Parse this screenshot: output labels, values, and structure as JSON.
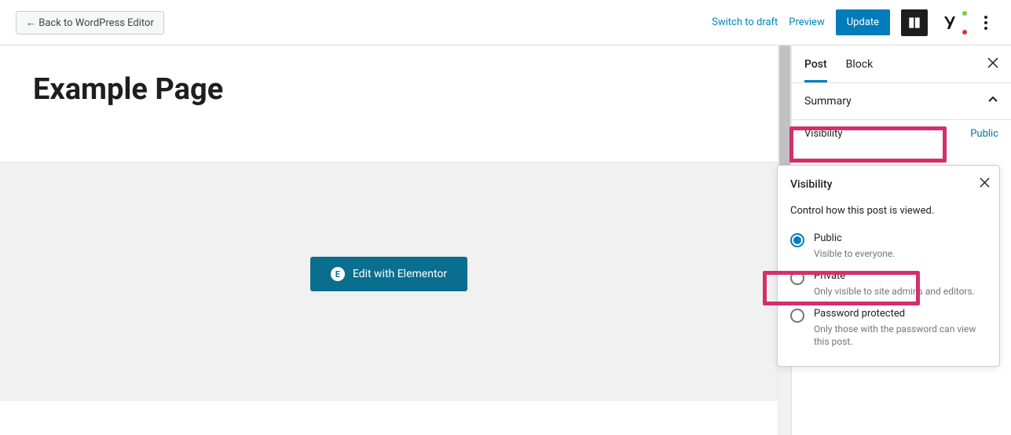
{
  "topbar": {
    "back_label": "← Back to WordPress Editor",
    "switch_draft": "Switch to draft",
    "preview": "Preview",
    "update": "Update"
  },
  "page": {
    "title": "Example Page",
    "edit_elementor": "Edit with Elementor"
  },
  "sidebar": {
    "tabs": {
      "post": "Post",
      "block": "Block"
    },
    "summary": {
      "label": "Summary",
      "visibility_label": "Visibility",
      "visibility_value": "Public"
    }
  },
  "visibility_popup": {
    "title": "Visibility",
    "description": "Control how this post is viewed.",
    "options": [
      {
        "label": "Public",
        "desc": "Visible to everyone.",
        "selected": true
      },
      {
        "label": "Private",
        "desc": "Only visible to site admins and editors.",
        "selected": false
      },
      {
        "label": "Password protected",
        "desc": "Only those with the password can view this post.",
        "selected": false
      }
    ]
  }
}
